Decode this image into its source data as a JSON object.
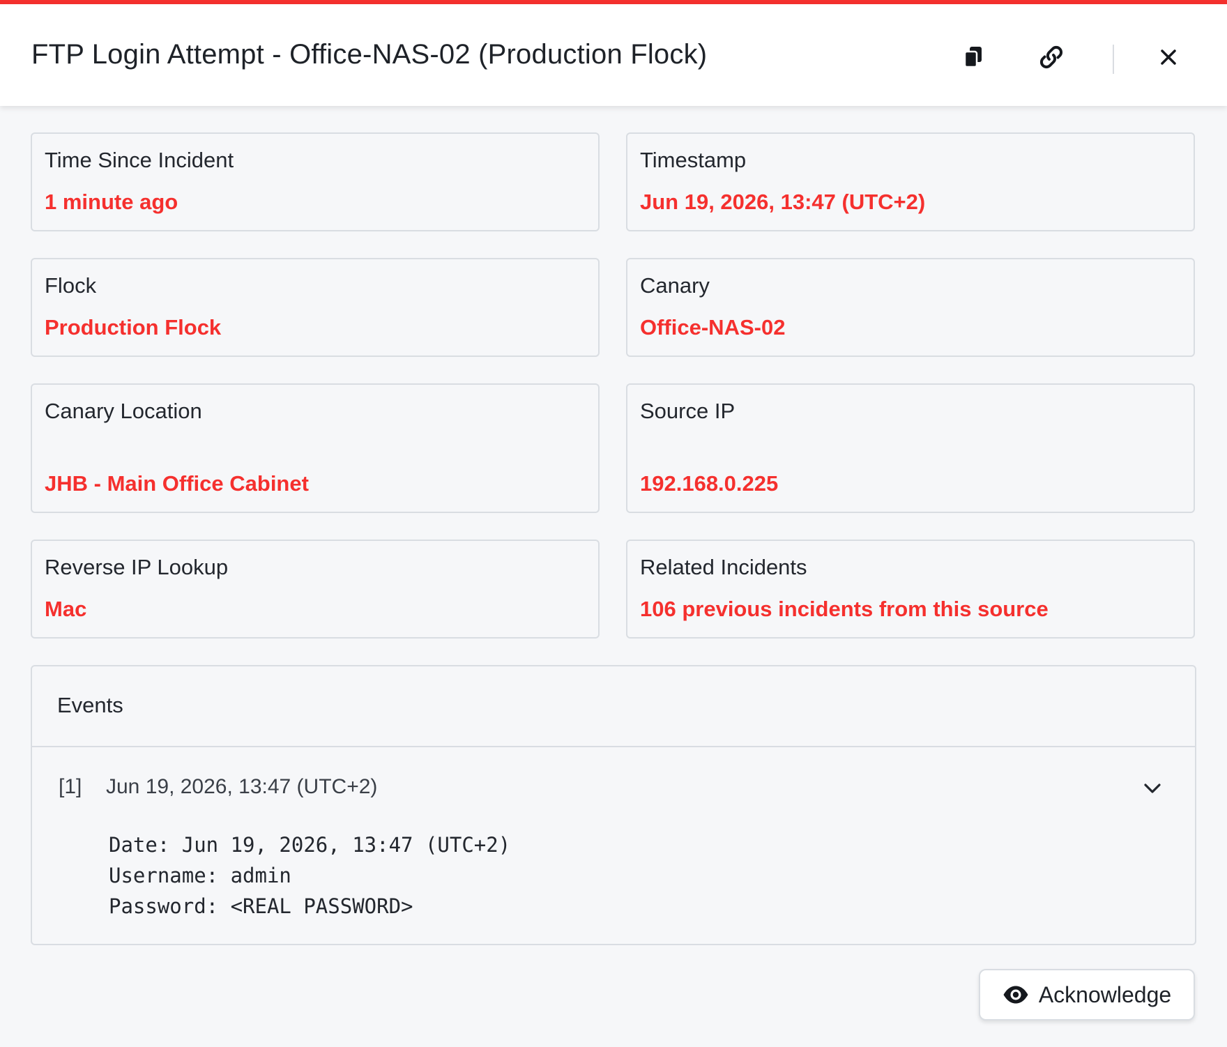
{
  "colors": {
    "accent": "#f5302e",
    "background": "#f6f7f9",
    "border": "#d9dde2",
    "text": "#1e2228"
  },
  "header": {
    "title": "FTP Login Attempt - Office-NAS-02 (Production Flock)",
    "icons": [
      "copy-icon",
      "link-icon",
      "close-icon"
    ]
  },
  "details": {
    "time_since": {
      "label": "Time Since Incident",
      "value": "1 minute ago"
    },
    "timestamp": {
      "label": "Timestamp",
      "value": "Jun 19, 2026, 13:47 (UTC+2)"
    },
    "flock": {
      "label": "Flock",
      "value": "Production Flock"
    },
    "canary": {
      "label": "Canary",
      "value": "Office-NAS-02"
    },
    "location": {
      "label": "Canary Location",
      "value": "JHB - Main Office Cabinet"
    },
    "source_ip": {
      "label": "Source IP",
      "value": "192.168.0.225"
    },
    "reverse_ip": {
      "label": "Reverse IP Lookup",
      "value": "Mac"
    },
    "related": {
      "label": "Related Incidents",
      "value": "106 previous incidents from this source"
    }
  },
  "events": {
    "title": "Events",
    "items": [
      {
        "index": "[1]",
        "time": "Jun 19, 2026, 13:47 (UTC+2)",
        "date_line": "Date: Jun 19, 2026, 13:47 (UTC+2)",
        "username_line": "Username: admin",
        "password_line": "Password: <REAL PASSWORD>"
      }
    ]
  },
  "actions": {
    "acknowledge_label": "Acknowledge",
    "acknowledge_icon": "eye-icon"
  }
}
